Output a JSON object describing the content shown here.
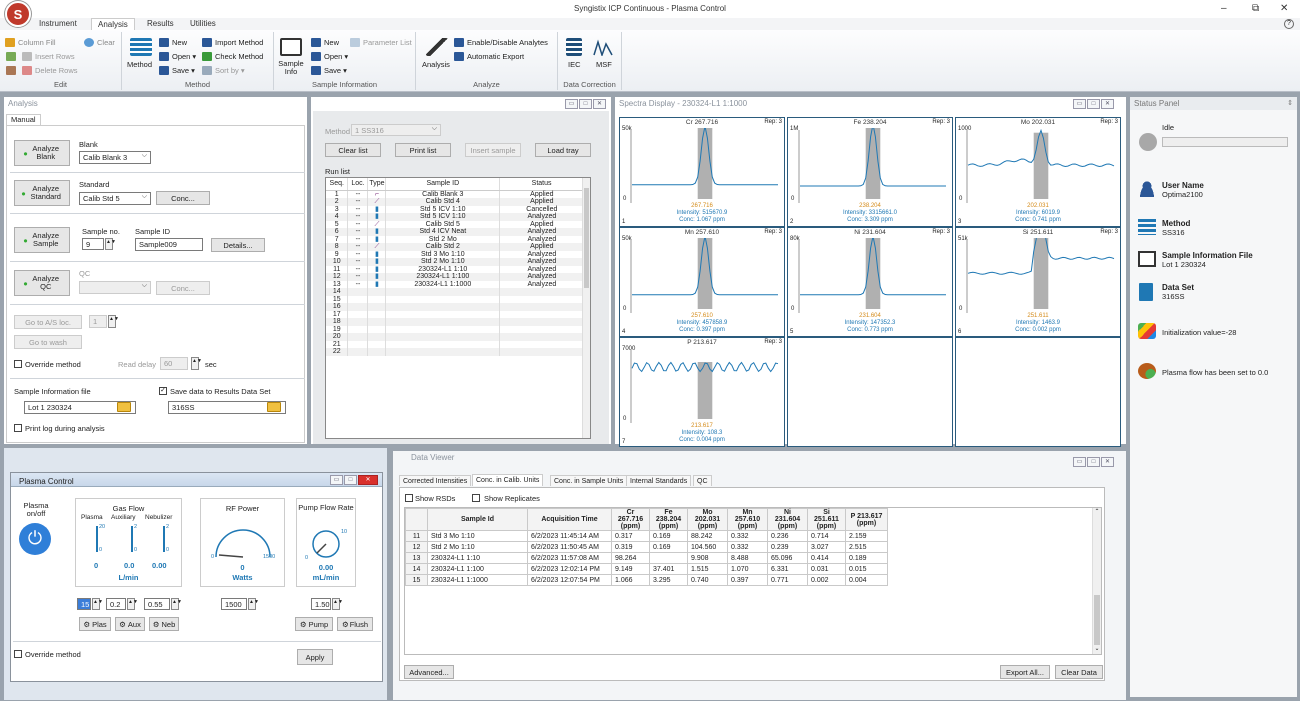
{
  "window": {
    "title": "Syngistix ICP Continuous - Plasma Control",
    "minimize": "–",
    "restore": "⧉",
    "close": "✕",
    "help": "?"
  },
  "logo": {
    "letter": "S"
  },
  "menu": {
    "tabs": [
      "Instrument",
      "Analysis",
      "Results",
      "Utilities"
    ],
    "active": "Analysis"
  },
  "ribbon": {
    "edit": {
      "label": "Edit",
      "column_fill": "Column Fill",
      "clear": "Clear",
      "insert_rows": "Insert Rows",
      "delete_rows": "Delete Rows"
    },
    "method": {
      "label": "Method",
      "big": "Method",
      "new": "New",
      "open": "Open ▾",
      "save": "Save ▾",
      "import": "Import Method",
      "check": "Check Method",
      "sort": "Sort by ▾"
    },
    "sample_info": {
      "label": "Sample Information",
      "big": "Sample Info",
      "new": "New",
      "open": "Open ▾",
      "save": "Save ▾",
      "param_list": "Parameter List"
    },
    "analyze": {
      "label": "Analyze",
      "big": "Analysis",
      "enable": "Enable/Disable Analytes",
      "export": "Automatic Export"
    },
    "data_correction": {
      "label": "Data Correction",
      "iec": "IEC",
      "msf": "MSF"
    }
  },
  "analysis": {
    "title": "Analysis",
    "tab": "Manual",
    "blank": {
      "button": "Analyze Blank",
      "label": "Blank",
      "value": "Calib Blank 3"
    },
    "standard": {
      "button": "Analyze Standard",
      "label": "Standard",
      "value": "Calib Std 5",
      "conc": "Conc..."
    },
    "sample": {
      "button": "Analyze Sample",
      "no_label": "Sample no.",
      "no": "9",
      "id_label": "Sample ID",
      "id": "Sample009",
      "details": "Details..."
    },
    "qc": {
      "button": "Analyze QC",
      "label": "QC",
      "conc": "Conc..."
    },
    "go_as": "Go to A/S loc.",
    "go_as_val": "1",
    "go_wash": "Go to wash",
    "override": "Override method",
    "read_delay_label": "Read delay",
    "read_delay": "60",
    "sec": "sec",
    "sif_label": "Sample Information file",
    "sif": "Lot 1 230324",
    "save_label": "Save data to Results Data Set",
    "save_val": "316SS",
    "print_log": "Print log during analysis"
  },
  "runlist": {
    "method_label": "Method",
    "method": "1  SS316",
    "clear": "Clear list",
    "print": "Print list",
    "insert": "Insert sample",
    "load": "Load tray",
    "title": "Run list",
    "headers": [
      "Seq.",
      "Loc.",
      "Type",
      "Sample ID",
      "Status"
    ],
    "rows": [
      [
        "1",
        "--",
        "Calib Blank 3",
        "Applied"
      ],
      [
        "2",
        "--",
        "Calib Std 4",
        "Applied"
      ],
      [
        "3",
        "--",
        "Std 5 ICV 1:10",
        "Cancelled"
      ],
      [
        "4",
        "--",
        "Std 5 ICV 1:10",
        "Analyzed"
      ],
      [
        "5",
        "--",
        "Calib Std 5",
        "Applied"
      ],
      [
        "6",
        "--",
        "Std 4 ICV Neat",
        "Analyzed"
      ],
      [
        "7",
        "--",
        "Std 2 Mo",
        "Analyzed"
      ],
      [
        "8",
        "--",
        "Calib Std 2",
        "Applied"
      ],
      [
        "9",
        "--",
        "Std 3 Mo 1:10",
        "Analyzed"
      ],
      [
        "10",
        "--",
        "Std 2 Mo 1:10",
        "Analyzed"
      ],
      [
        "11",
        "--",
        "230324-L1 1:10",
        "Analyzed"
      ],
      [
        "12",
        "--",
        "230324-L1 1:100",
        "Analyzed"
      ],
      [
        "13",
        "--",
        "230324-L1 1:1000",
        "Analyzed"
      ],
      [
        "14",
        "",
        "",
        ""
      ],
      [
        "15",
        "",
        "",
        ""
      ],
      [
        "16",
        "",
        "",
        ""
      ],
      [
        "17",
        "",
        "",
        ""
      ],
      [
        "18",
        "",
        "",
        ""
      ],
      [
        "19",
        "",
        "",
        ""
      ],
      [
        "20",
        "",
        "",
        ""
      ],
      [
        "21",
        "",
        "",
        ""
      ],
      [
        "22",
        "",
        "",
        ""
      ]
    ]
  },
  "spectra": {
    "title": "Spectra Display - 230324-L1 1:1000",
    "plots": [
      {
        "n": "1",
        "title": "Cr 267.716",
        "rep": "Rep: 3",
        "max": "50k",
        "wl": "267.716",
        "int": "Intensity: 515670.9",
        "conc": "Conc: 1.067 ppm"
      },
      {
        "n": "2",
        "title": "Fe 238.204",
        "rep": "Rep: 3",
        "max": "1M",
        "wl": "238.204",
        "int": "Intensity: 3315661.0",
        "conc": "Conc: 3.309 ppm"
      },
      {
        "n": "3",
        "title": "Mo 202.031",
        "rep": "Rep: 3",
        "max": "1000",
        "wl": "202.031",
        "int": "Intensity: 6019.9",
        "conc": "Conc: 0.741 ppm"
      },
      {
        "n": "4",
        "title": "Mn 257.610",
        "rep": "Rep: 3",
        "max": "50k",
        "wl": "257.610",
        "int": "Intensity: 457858.9",
        "conc": "Conc: 0.397 ppm"
      },
      {
        "n": "5",
        "title": "Ni 231.604",
        "rep": "Rep: 3",
        "max": "80k",
        "wl": "231.604",
        "int": "Intensity: 147352.3",
        "conc": "Conc: 0.773 ppm"
      },
      {
        "n": "6",
        "title": "Si 251.611",
        "rep": "Rep: 3",
        "max": "51k",
        "wl": "251.611",
        "int": "Intensity: 1463.9",
        "conc": "Conc: 0.002 ppm"
      },
      {
        "n": "7",
        "title": "P 213.617",
        "rep": "Rep: 3",
        "max": "7000",
        "wl": "213.617",
        "int": "Intensity: 108.3",
        "conc": "Conc: 0.004 ppm"
      }
    ]
  },
  "status": {
    "title": "Status Panel",
    "pin": "⇕",
    "state": "Idle",
    "user_label": "User Name",
    "user": "Optima2100",
    "method_label": "Method",
    "method": "SS316",
    "sif_label": "Sample Information File",
    "sif": "Lot 1 230324",
    "ds_label": "Data Set",
    "ds": "316SS",
    "init": "Initialization value=-28",
    "plasma": "Plasma flow has been set to 0.0"
  },
  "plasma": {
    "title": "Plasma Control",
    "onoff": "Plasma on/off",
    "gas_title": "Gas Flow",
    "gas_cols": [
      "Plasma",
      "Auxiliary",
      "Nebulizer"
    ],
    "gas_vals": [
      "0",
      "0.0",
      "0.00"
    ],
    "gas_unit": "L/min",
    "gas_scale": {
      "plasma": [
        "20",
        "0"
      ],
      "aux": [
        "2",
        "0"
      ],
      "neb": [
        "2",
        "0"
      ]
    },
    "gas_inputs": [
      "15",
      "0.2",
      "0.55"
    ],
    "rf_title": "RF Power",
    "rf_val": "0",
    "rf_unit": "Watts",
    "rf_min": "0",
    "rf_max": "1500",
    "rf_input": "1500",
    "pump_title": "Pump Flow Rate",
    "pump_val": "0.00",
    "pump_unit": "mL/min",
    "pump_min": "0",
    "pump_max": "10",
    "pump_input": "1.50",
    "btn_plas": "Plas",
    "btn_aux": "Aux",
    "btn_neb": "Neb",
    "btn_pump": "Pump",
    "btn_flush": "Flush",
    "override": "Override method",
    "apply": "Apply"
  },
  "dataviewer": {
    "title": "Data Viewer",
    "tabs": [
      "Corrected Intensities",
      "Conc. in Calib. Units",
      "Conc. in Sample Units",
      "Internal Standards",
      "QC"
    ],
    "active_tab": 1,
    "show_rsds": "Show RSDs",
    "show_reps": "Show Replicates",
    "headers": [
      "Sample Id",
      "Acquisition Time",
      "Cr 267.716 (ppm)",
      "Fe 238.204 (ppm)",
      "Mo 202.031 (ppm)",
      "Mn 257.610 (ppm)",
      "Ni 231.604 (ppm)",
      "Si 251.611 (ppm)",
      "P 213.617 (ppm)"
    ],
    "rows": [
      [
        "11",
        "Std 3 Mo 1:10",
        "6/2/2023 11:45:14 AM",
        "0.317",
        "0.169",
        "88.242",
        "0.332",
        "0.236",
        "0.714",
        "2.159"
      ],
      [
        "12",
        "Std 2 Mo 1:10",
        "6/2/2023 11:50:45 AM",
        "0.319",
        "0.169",
        "104.560",
        "0.332",
        "0.239",
        "3.027",
        "2.515"
      ],
      [
        "13",
        "230324-L1 1:10",
        "6/2/2023 11:57:08 AM",
        "98.264",
        "",
        "9.908",
        "8.488",
        "65.096",
        "0.414",
        "0.189"
      ],
      [
        "14",
        "230324-L1 1:100",
        "6/2/2023 12:02:14 PM",
        "9.149",
        "37.401",
        "1.515",
        "1.070",
        "6.331",
        "0.031",
        "0.015"
      ],
      [
        "15",
        "230324-L1 1:1000",
        "6/2/2023 12:07:54 PM",
        "1.066",
        "3.295",
        "0.740",
        "0.397",
        "0.771",
        "0.002",
        "0.004"
      ]
    ],
    "advanced": "Advanced...",
    "export": "Export All...",
    "clear": "Clear Data"
  },
  "colors": {
    "accent": "#1f78b4",
    "peak": "#aaaaaa",
    "plasma_btn": "#2f7fd8",
    "close_red": "#d9302c"
  }
}
